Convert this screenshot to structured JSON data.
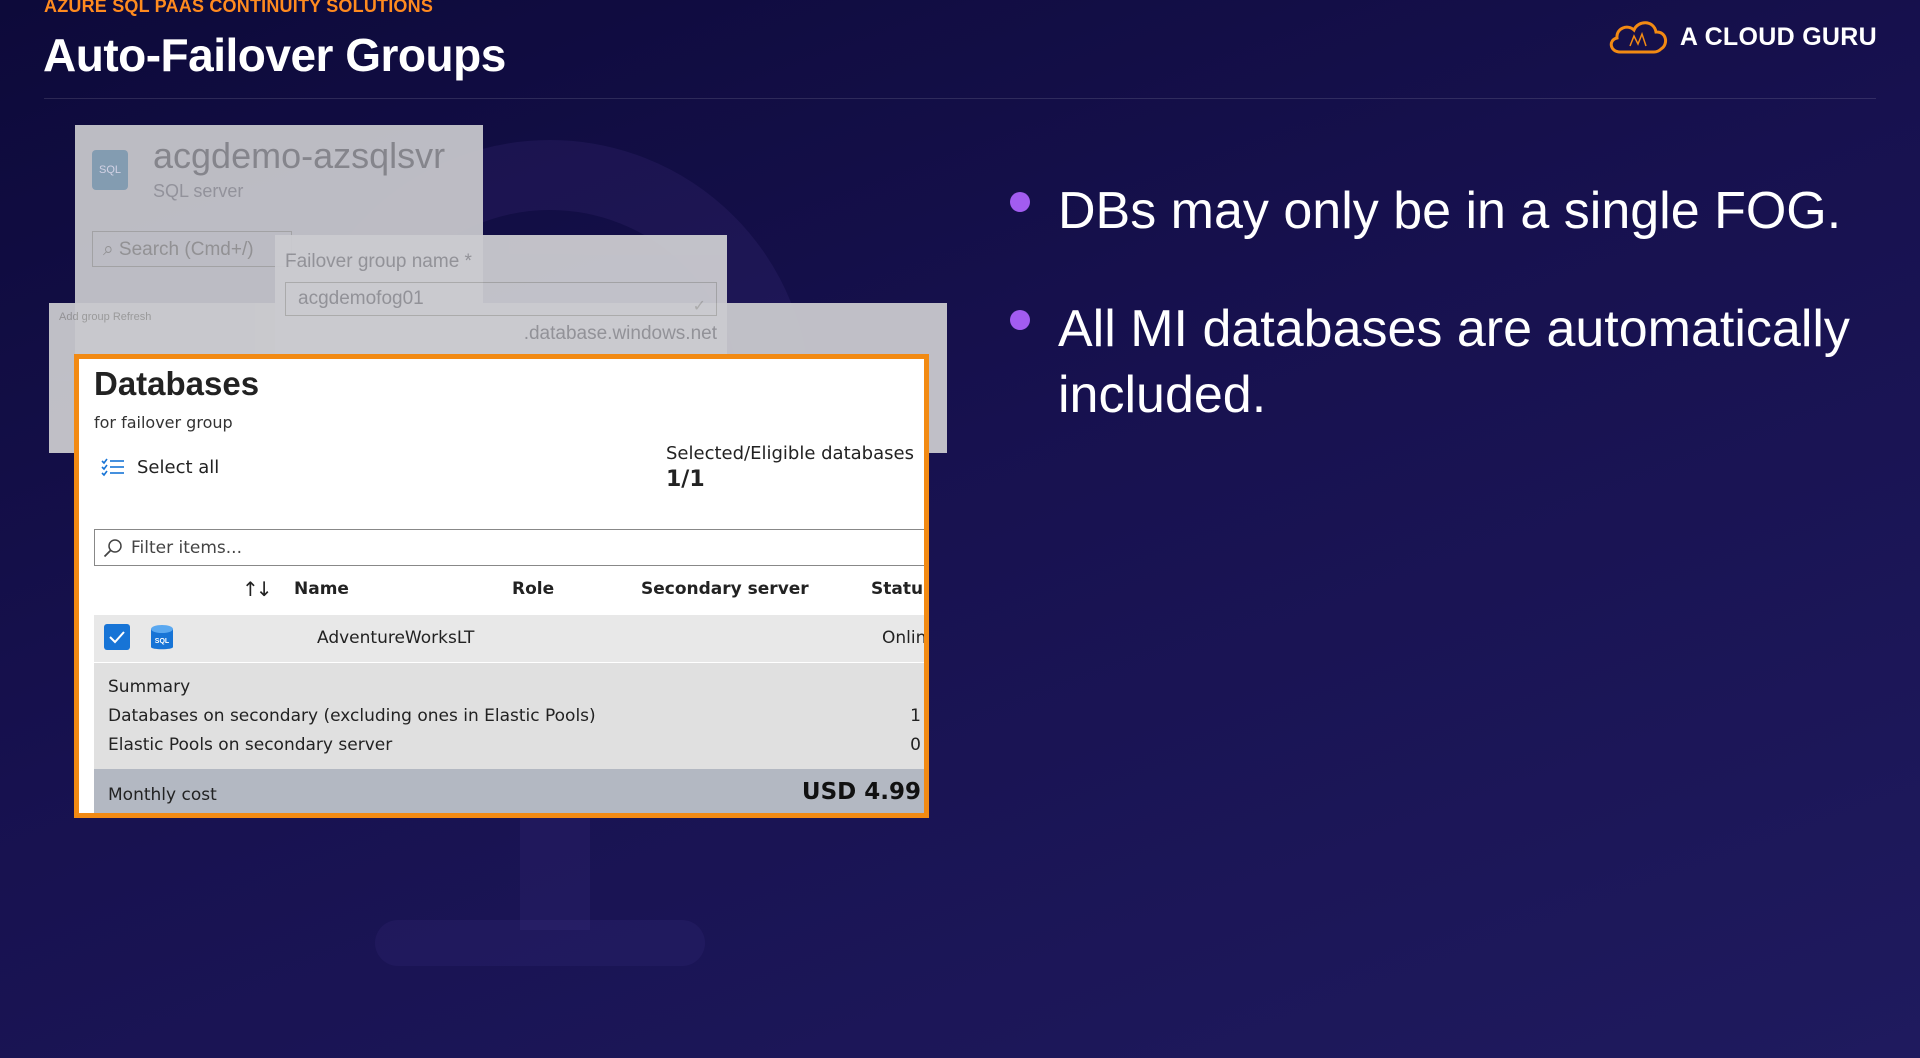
{
  "header": {
    "kicker": "AZURE SQL PAAS CONTINUITY SOLUTIONS",
    "title": "Auto-Failover Groups",
    "brand": "A CLOUD GURU"
  },
  "colors": {
    "accent": "#f28a13",
    "bullet": "#a25cf0",
    "checkbox": "#1774d6"
  },
  "background_panels": {
    "server_name": "acgdemo-azsqlsvr",
    "server_type": "SQL server",
    "search_placeholder": "Search (Cmd+/)",
    "failover_label": "Failover group name *",
    "failover_value": "acgdemofog01",
    "failover_suffix": ".database.windows.net",
    "toolbar_text": "Add group   Refresh"
  },
  "panel": {
    "title": "Databases",
    "subtitle": "for failover group",
    "select_all": "Select all",
    "eligible_label": "Selected/Eligible databases",
    "eligible_count": "1/1",
    "filter_placeholder": "Filter items...",
    "columns": [
      "Name",
      "Role",
      "Secondary server",
      "Status"
    ],
    "rows": [
      {
        "name": "AdventureWorksLT",
        "role": "",
        "secondary_server": "",
        "status": "Online",
        "checked": true
      }
    ],
    "summary": {
      "heading": "Summary",
      "lines": [
        {
          "label": "Databases on secondary (excluding ones in Elastic Pools)",
          "value": "1"
        },
        {
          "label": "Elastic Pools on secondary server",
          "value": "0"
        }
      ]
    },
    "cost": {
      "label": "Monthly cost",
      "value": "USD 4.99"
    }
  },
  "bullets": [
    "DBs may only be in a single FOG.",
    "All MI databases are automatically included."
  ]
}
